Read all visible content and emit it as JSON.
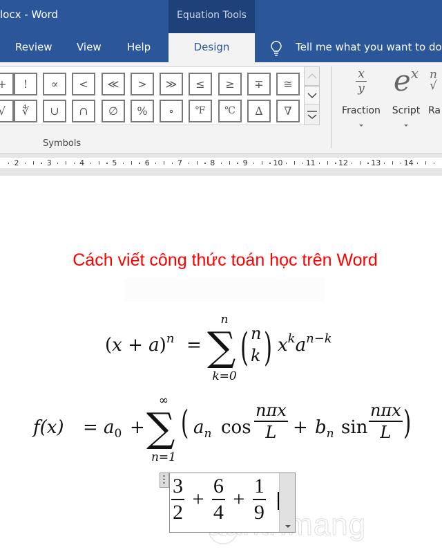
{
  "window": {
    "title": "locx  -  Word",
    "context_tab_group": "Equation Tools"
  },
  "tabs": [
    {
      "label": "Review",
      "active": false
    },
    {
      "label": "View",
      "active": false
    },
    {
      "label": "Help",
      "active": false
    },
    {
      "label": "Design",
      "active": true
    }
  ],
  "tell_me": {
    "icon": "lightbulb-icon",
    "placeholder": "Tell me what you want to do"
  },
  "ribbon": {
    "symbols_group": {
      "label": "Symbols",
      "row1": [
        "+",
        "!",
        "∝",
        "<",
        "≪",
        ">",
        "≫",
        "≤",
        "≥",
        "∓",
        "≅"
      ],
      "row2": [
        "√",
        "∜",
        "∪",
        "∩",
        "∅",
        "%",
        "∘",
        "℉",
        "℃",
        "∆",
        "∇"
      ],
      "scroll_buttons": [
        "scroll-up",
        "scroll-down",
        "more"
      ]
    },
    "structures": [
      {
        "label": "Fraction",
        "icon": "fraction-icon",
        "icon_top": "x",
        "icon_bottom": "y"
      },
      {
        "label": "Script",
        "icon": "script-icon",
        "icon_base": "e",
        "icon_sup": "x"
      },
      {
        "label": "Ra",
        "icon": "radical-icon",
        "icon_text": "n√"
      }
    ]
  },
  "ruler": {
    "numbers": [
      "2",
      "3",
      "4",
      "5",
      "6",
      "7",
      "8",
      "9",
      "10",
      "11",
      "12",
      "13",
      "14"
    ]
  },
  "document": {
    "heading": "Cách viết công thức toán học trên Word",
    "heading_color": "#ff0000",
    "equations": {
      "binomial": {
        "lhs_open": "(",
        "lhs_x": "x",
        "lhs_plus": " + ",
        "lhs_a": "a",
        "lhs_close": ")",
        "lhs_exp": "n",
        "equals": "=",
        "sum_upper": "n",
        "sum_lower": "k=0",
        "binom_top": "n",
        "binom_bottom": "k",
        "term_x": "x",
        "term_x_exp": "k",
        "term_a": "a",
        "term_a_exp": "n−k"
      },
      "fourier": {
        "lhs": "f(x)",
        "equals": "=",
        "a0_base": "a",
        "a0_sub": "0",
        "plus": "+",
        "sum_upper": "∞",
        "sum_lower": "n=1",
        "an_base": "a",
        "an_sub": "n",
        "cos": "cos",
        "frac_num": "nπx",
        "frac_den": "L",
        "bn_base": "b",
        "bn_sub": "n",
        "sin": "sin"
      },
      "editing": {
        "f1_num": "3",
        "f1_den": "2",
        "f2_num": "6",
        "f2_den": "4",
        "f3_num": "1",
        "f3_den": "9",
        "plus": "+",
        "equals": "="
      }
    },
    "watermark": "uantrimang"
  }
}
